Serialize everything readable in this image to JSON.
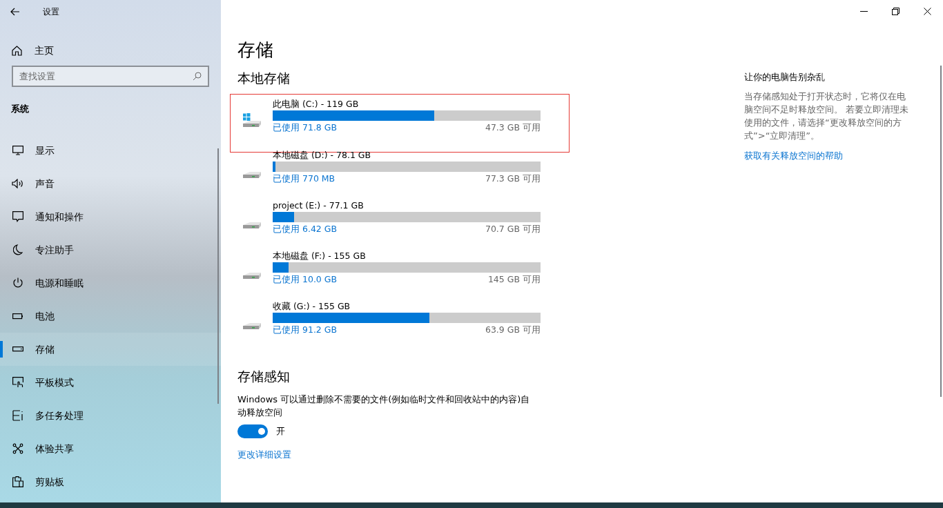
{
  "window": {
    "title": "设置"
  },
  "sidebar": {
    "home": "主页",
    "search": {
      "placeholder": "查找设置"
    },
    "section": "系统",
    "items": [
      {
        "label": "显示",
        "selected": false
      },
      {
        "label": "声音",
        "selected": false
      },
      {
        "label": "通知和操作",
        "selected": false
      },
      {
        "label": "专注助手",
        "selected": false
      },
      {
        "label": "电源和睡眠",
        "selected": false
      },
      {
        "label": "电池",
        "selected": false
      },
      {
        "label": "存储",
        "selected": true
      },
      {
        "label": "平板模式",
        "selected": false
      },
      {
        "label": "多任务处理",
        "selected": false
      },
      {
        "label": "体验共享",
        "selected": false
      },
      {
        "label": "剪贴板",
        "selected": false
      }
    ]
  },
  "page": {
    "title": "存储",
    "local_heading": "本地存储",
    "drives": [
      {
        "name": "此电脑 (C:) - 119 GB",
        "used": "已使用 71.8 GB",
        "free": "47.3 GB 可用",
        "level": 0.603,
        "system": true,
        "highlighted": true
      },
      {
        "name": "本地磁盘 (D:) - 78.1 GB",
        "used": "已使用 770 MB",
        "free": "77.3 GB 可用",
        "level": 0.01,
        "system": false,
        "highlighted": false
      },
      {
        "name": "project (E:) - 77.1 GB",
        "used": "已使用 6.42 GB",
        "free": "70.7 GB 可用",
        "level": 0.08,
        "system": false,
        "highlighted": false
      },
      {
        "name": "本地磁盘 (F:) - 155 GB",
        "used": "已使用 10.0 GB",
        "free": "145 GB 可用",
        "level": 0.06,
        "system": false,
        "highlighted": false
      },
      {
        "name": "收藏 (G:) - 155 GB",
        "used": "已使用 91.2 GB",
        "free": "63.9 GB 可用",
        "level": 0.585,
        "system": false,
        "highlighted": false
      }
    ],
    "sense": {
      "heading": "存储感知",
      "description": "Windows 可以通过删除不需要的文件(例如临时文件和回收站中的内容)自动释放空间",
      "toggle": {
        "on": true,
        "label": "开"
      },
      "link": "更改详细设置"
    }
  },
  "aside": {
    "title": "让你的电脑告别杂乱",
    "body": "当存储感知处于打开状态时，它将仅在电脑空间不足时释放空间。 若要立即清理未使用的文件，请选择“更改释放空间的方式”>“立即清理”。",
    "link": "获取有关释放空间的帮助"
  }
}
